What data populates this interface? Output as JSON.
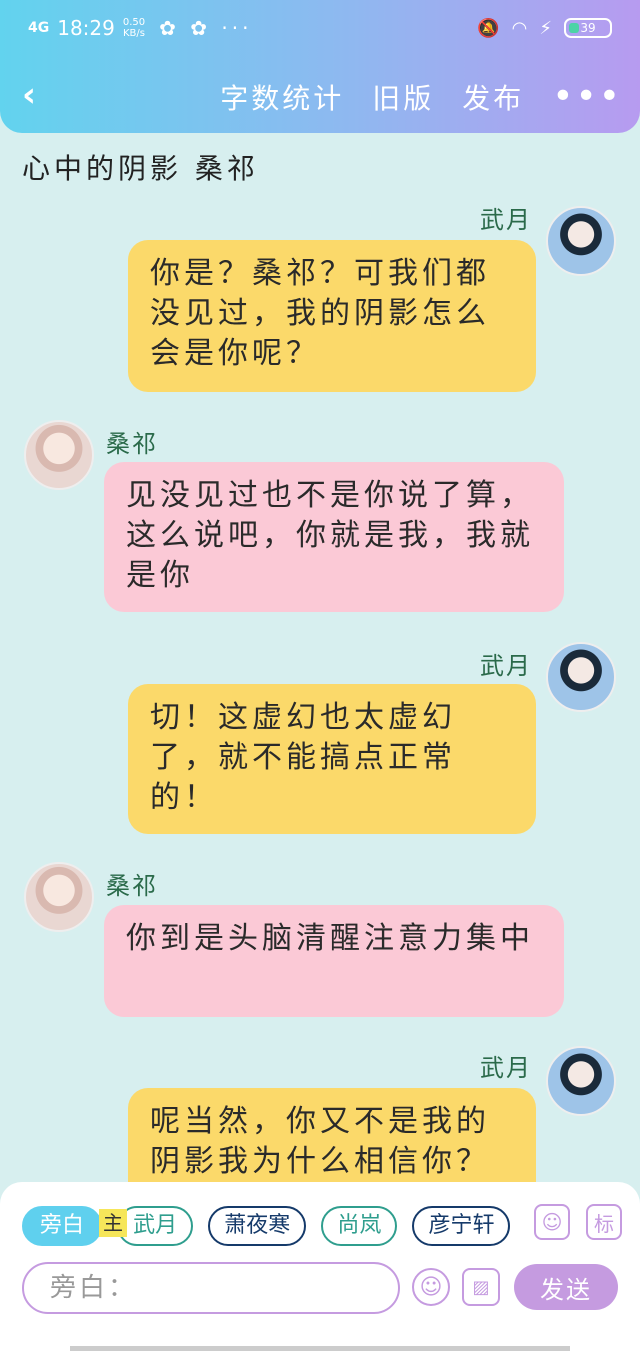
{
  "status": {
    "network": "4G",
    "time": "18:29",
    "speed_value": "0.50",
    "speed_unit": "KB/s",
    "apps": "✿ ✿ ···",
    "battery": "39"
  },
  "nav": {
    "word_count": "字数统计",
    "old_version": "旧版",
    "publish": "发布",
    "more": "•••"
  },
  "title": "心中的阴影 桑祁",
  "messages": [
    {
      "sender": "武月",
      "side": "right",
      "text": "你是？桑祁？可我们都没见过，我的阴影怎么会是你呢？"
    },
    {
      "sender": "桑祁",
      "side": "left",
      "text": "见没见过也不是你说了算，这么说吧，你就是我，我就是你"
    },
    {
      "sender": "武月",
      "side": "right",
      "text": "切！这虚幻也太虚幻了，就不能搞点正常的！"
    },
    {
      "sender": "桑祁",
      "side": "left",
      "text": "你到是头脑清醒注意力集中"
    },
    {
      "sender": "武月",
      "side": "right",
      "text": "呢当然，你又不是我的阴影我为什么相信你？"
    }
  ],
  "roles": [
    "旁白",
    "武月",
    "萧夜寒",
    "尚岚",
    "彦宁轩"
  ],
  "main_badge": "主",
  "role_icon_label": "标",
  "input_placeholder": "旁白：",
  "send_label": "发送"
}
